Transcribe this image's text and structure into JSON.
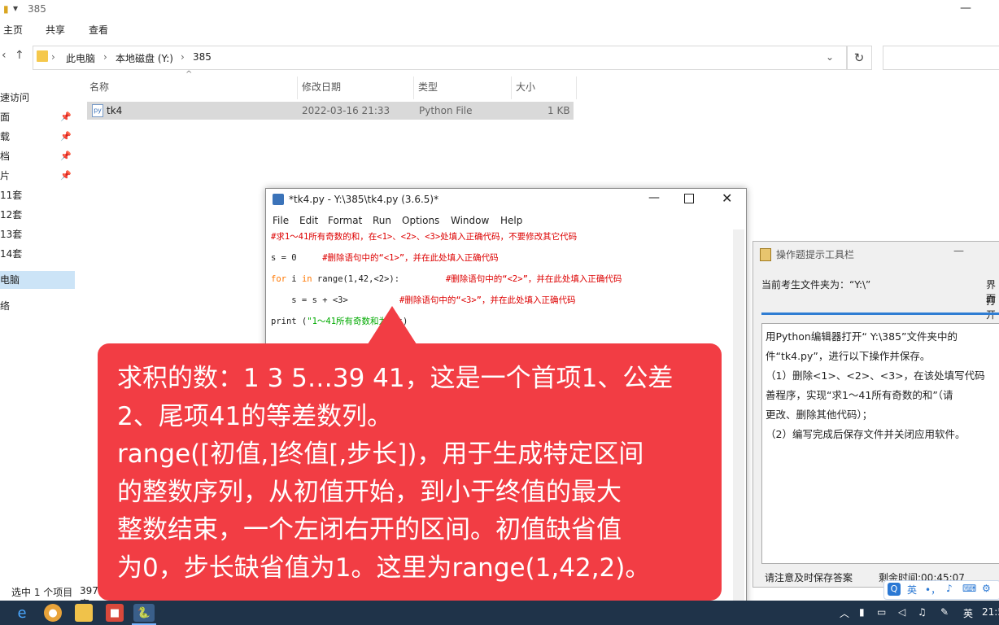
{
  "explorer": {
    "title": "385",
    "ribbon": [
      "主页",
      "共享",
      "查看"
    ],
    "breadcrumb": [
      "此电脑",
      "本地磁盘 (Y:)",
      "385"
    ],
    "sidebar": [
      "速访问",
      "面",
      "载",
      "档",
      "片",
      "11套",
      "12套",
      "13套",
      "14套",
      "电脑",
      "络"
    ],
    "columns": [
      "名称",
      "修改日期",
      "类型",
      "大小"
    ],
    "file": {
      "name": "tk4",
      "date": "2022-03-16 21:33",
      "type": "Python File",
      "size": "1 KB"
    },
    "status": "选中 1 个项目",
    "status_size": "397 字"
  },
  "idle": {
    "title": "*tk4.py - Y:\\385\\tk4.py (3.6.5)*",
    "menu": [
      "File",
      "Edit",
      "Format",
      "Run",
      "Options",
      "Window",
      "Help"
    ],
    "code": {
      "l1": "#求1～41所有奇数的和，在<1>、<2>、<3>处填入正确代码，不要修改其它代码",
      "l2a": "s = 0     ",
      "l2b": "#删除语句中的“<1>”，并在此处填入正确代码",
      "l3kw1": "for",
      "l3a": " i ",
      "l3kw2": "in",
      "l3b": " range(1,42,<2>):         ",
      "l3c": "#删除语句中的“<2>”，并在此处填入正确代码",
      "l4a": "    s = s + <3>          ",
      "l4b": "#删除语句中的“<3>”，并在此处填入正确代码",
      "l5a": "print (",
      "l5b": "\"1～41所有奇数和为\"",
      "l5c": ",s)"
    }
  },
  "helper": {
    "title": "操作题提示工具栏",
    "folder": "当前考生文件夹为：“Y:\\”",
    "side1": "界面",
    "side2": "打开",
    "text": [
      "用Python编辑器打开“ Y:\\385”文件夹中的",
      "件“tk4.py”，进行以下操作并保存。",
      "（1）删除<1>、<2>、<3>，在该处填写代码",
      "善程序，实现“求1～41所有奇数的和”（请",
      "更改、删除其他代码）；",
      "（2）编写完成后保存文件并关闭应用软件。"
    ],
    "footer_left": "请注意及时保存答案",
    "footer_right": "剩余时间:00:45:07"
  },
  "callout": {
    "lines": [
      "求积的数：1 3 5…39 41，这是一个首项1、公差",
      "2、尾项41的等差数列。",
      "range([初值,]终值[,步长])，用于生成特定区间",
      "的整数序列，从初值开始，到小于终值的最大",
      "整数结束，一个左闭右开的区间。初值缺省值",
      "为0，步长缺省值为1。这里为range(1,42,2)。"
    ]
  },
  "taskbar": {
    "tray_lang": "英",
    "clock": "21:5"
  },
  "ime": {
    "mode": "英",
    "punct": "•，"
  }
}
